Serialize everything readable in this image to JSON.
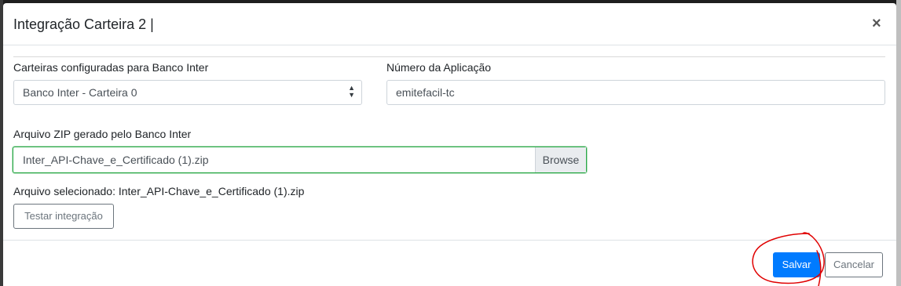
{
  "modal": {
    "title": "Integração Carteira 2 |",
    "close_glyph": "×"
  },
  "form": {
    "wallets_label": "Carteiras configuradas para Banco Inter",
    "wallets_selected": "Banco Inter - Carteira 0",
    "app_number_label": "Número da Aplicação",
    "app_number_value": "emitefacil-tc",
    "zip_label": "Arquivo ZIP gerado pelo Banco Inter",
    "zip_file_name": "Inter_API-Chave_e_Certificado (1).zip",
    "browse_label": "Browse",
    "selected_file_text": "Arquivo selecionado: Inter_API-Chave_e_Certificado (1).zip",
    "test_button": "Testar integração"
  },
  "footer": {
    "save_label": "Salvar",
    "cancel_label": "Cancelar"
  },
  "colors": {
    "primary": "#007bff",
    "valid_border": "#28a745",
    "annotation": "#e00000"
  },
  "icons": {
    "close": "close-icon",
    "select_arrows": "sort-arrows-icon"
  }
}
